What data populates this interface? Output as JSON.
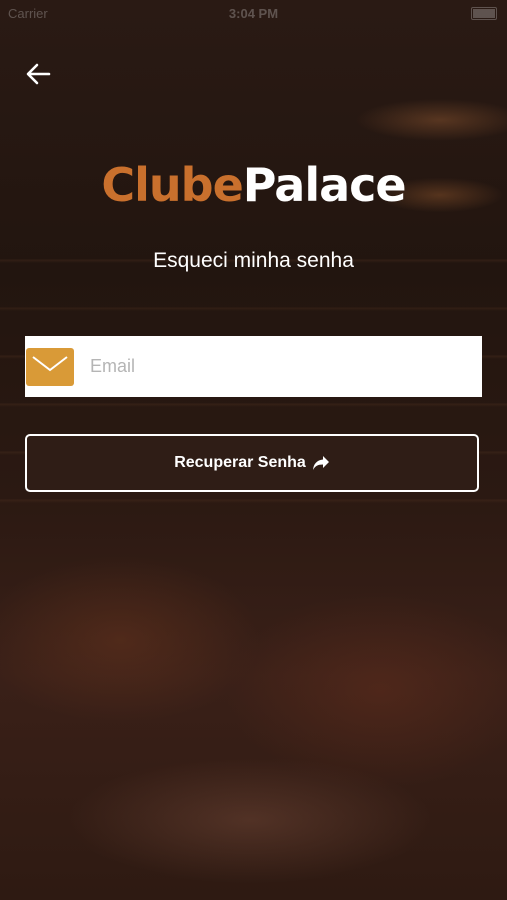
{
  "status_bar": {
    "carrier": "Carrier",
    "time": "3:04 PM"
  },
  "logo": {
    "part1": "Clube",
    "part2": "Palace"
  },
  "subtitle": "Esqueci minha senha",
  "email": {
    "placeholder": "Email",
    "value": "",
    "icon": "mail-icon",
    "icon_bg": "#d99a37"
  },
  "recover_button": {
    "label": "Recuperar Senha",
    "icon": "share-arrow-icon"
  },
  "colors": {
    "brand_orange": "#c9702d",
    "icon_gold": "#d99a37"
  }
}
